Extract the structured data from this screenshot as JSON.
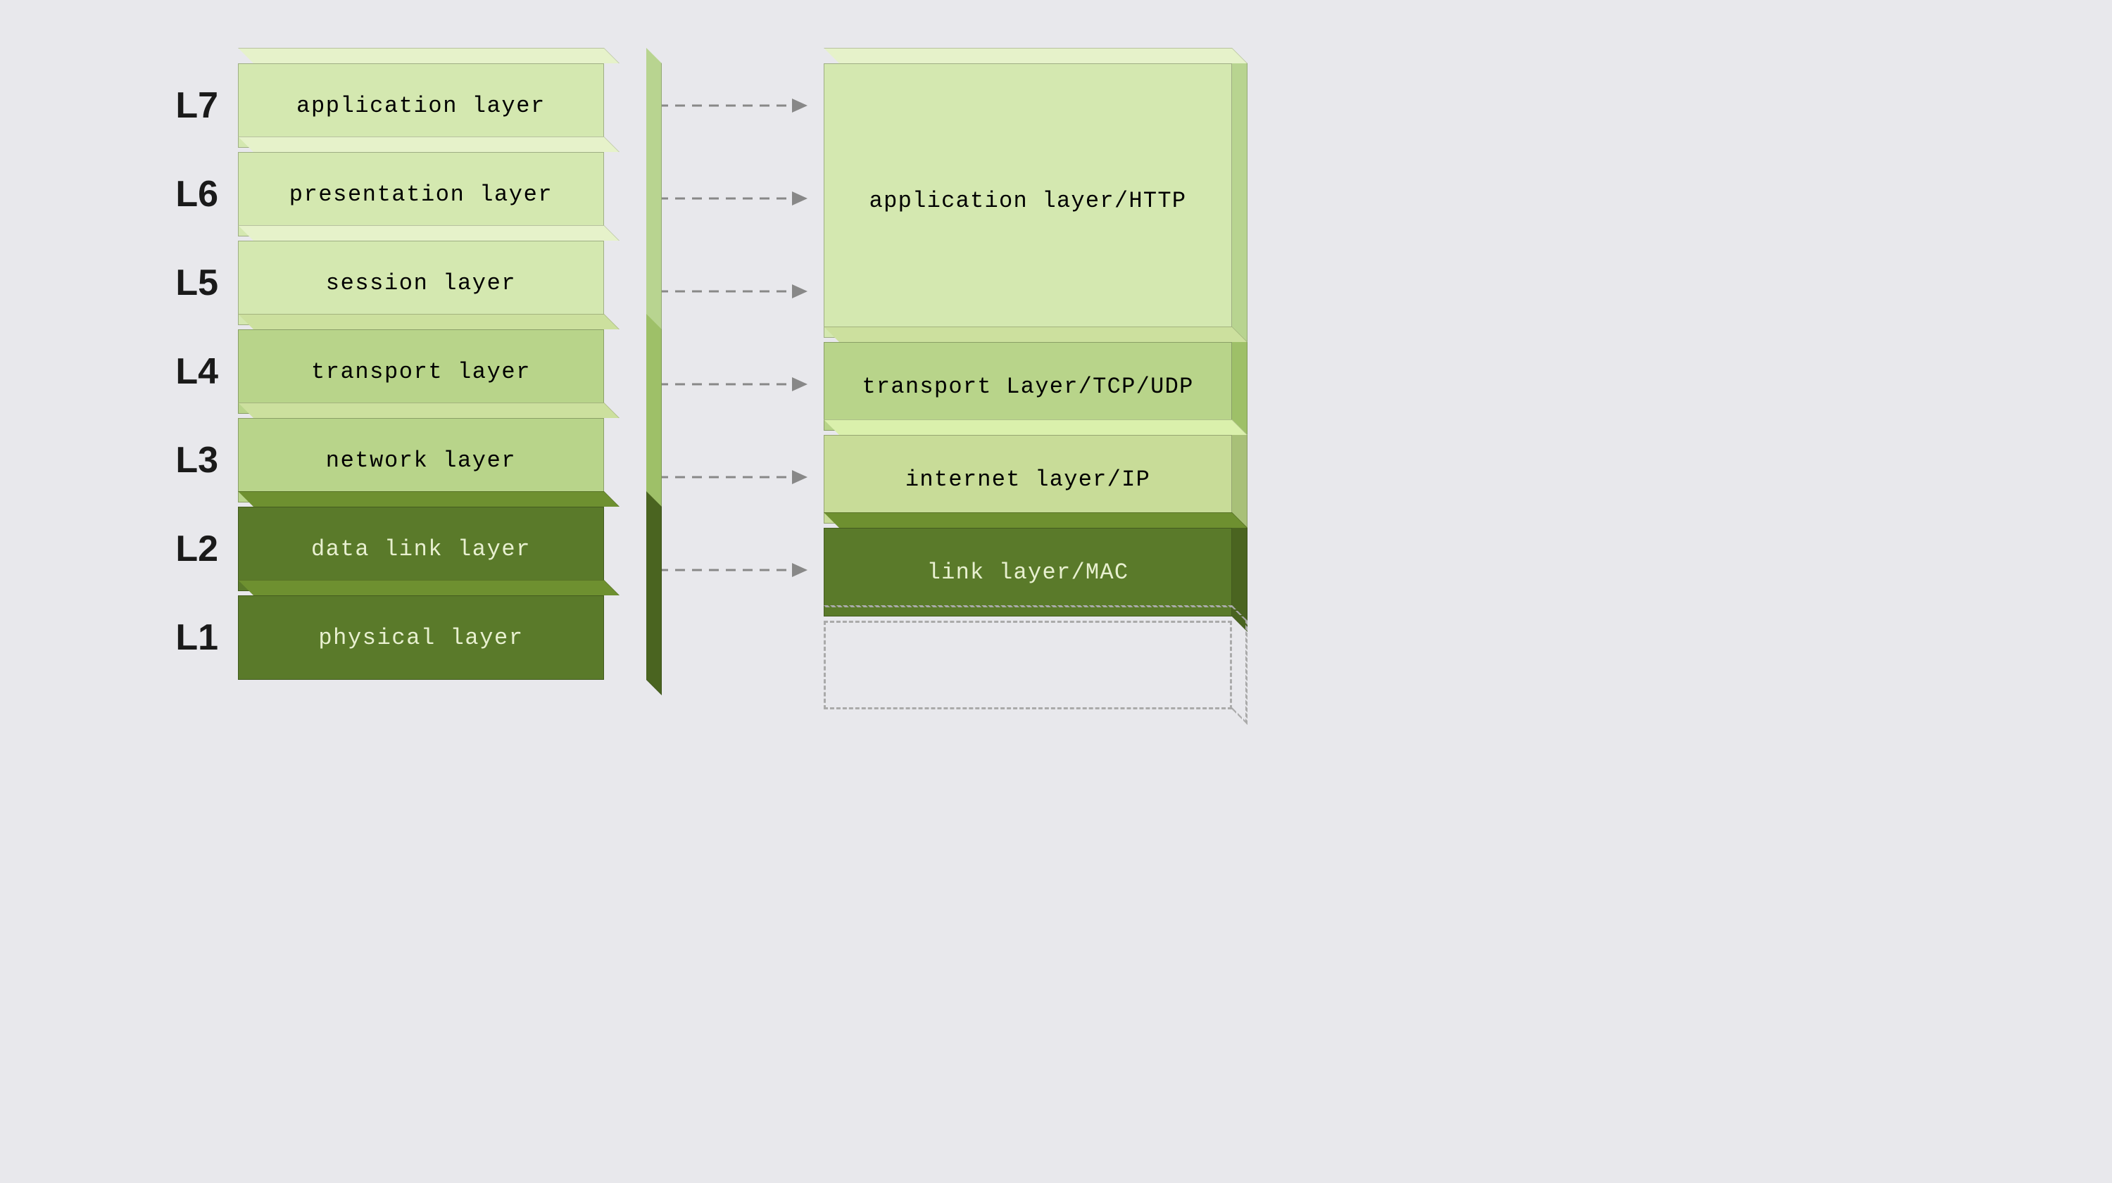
{
  "osi_layers": [
    {
      "id": "l7",
      "label": "L7",
      "name": "application layer",
      "color": "light"
    },
    {
      "id": "l6",
      "label": "L6",
      "name": "presentation layer",
      "color": "light"
    },
    {
      "id": "l5",
      "label": "L5",
      "name": "session layer",
      "color": "light"
    },
    {
      "id": "l4",
      "label": "L4",
      "name": "transport layer",
      "color": "medium"
    },
    {
      "id": "l3",
      "label": "L3",
      "name": "network layer",
      "color": "medium"
    },
    {
      "id": "l2",
      "label": "L2",
      "name": "data link layer",
      "color": "dark"
    },
    {
      "id": "l1",
      "label": "L1",
      "name": "physical layer",
      "color": "dark"
    }
  ],
  "tcpip_layers": [
    {
      "id": "app",
      "name": "application layer/HTTP",
      "type": "app"
    },
    {
      "id": "transport",
      "name": "transport Layer/TCP/UDP",
      "type": "transport"
    },
    {
      "id": "internet",
      "name": "internet layer/IP",
      "type": "internet"
    },
    {
      "id": "link",
      "name": "link layer/MAC",
      "type": "link"
    },
    {
      "id": "empty",
      "name": "",
      "type": "empty"
    }
  ],
  "arrow_rows": [
    {
      "id": "arr7",
      "show": true
    },
    {
      "id": "arr6",
      "show": true
    },
    {
      "id": "arr5",
      "show": true
    },
    {
      "id": "arr4",
      "show": true
    },
    {
      "id": "arr3",
      "show": true
    },
    {
      "id": "arr2",
      "show": true
    },
    {
      "id": "arr1",
      "show": false
    }
  ]
}
